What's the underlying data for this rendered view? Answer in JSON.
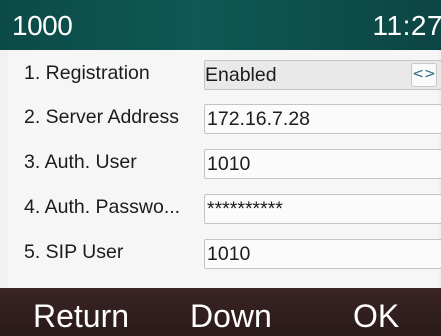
{
  "status": {
    "title": "1000",
    "time": "11:27"
  },
  "rows": [
    {
      "label": "1. Registration",
      "value": "Enabled",
      "toggle": "<>"
    },
    {
      "label": "2. Server Address",
      "value": "172.16.7.28"
    },
    {
      "label": "3. Auth. User",
      "value": "1010"
    },
    {
      "label": "4. Auth. Passwo...",
      "value": "**********"
    },
    {
      "label": "5. SIP User",
      "value": "1010"
    }
  ],
  "softkeys": {
    "left": "Return",
    "middle": "Down",
    "right": "OK"
  }
}
